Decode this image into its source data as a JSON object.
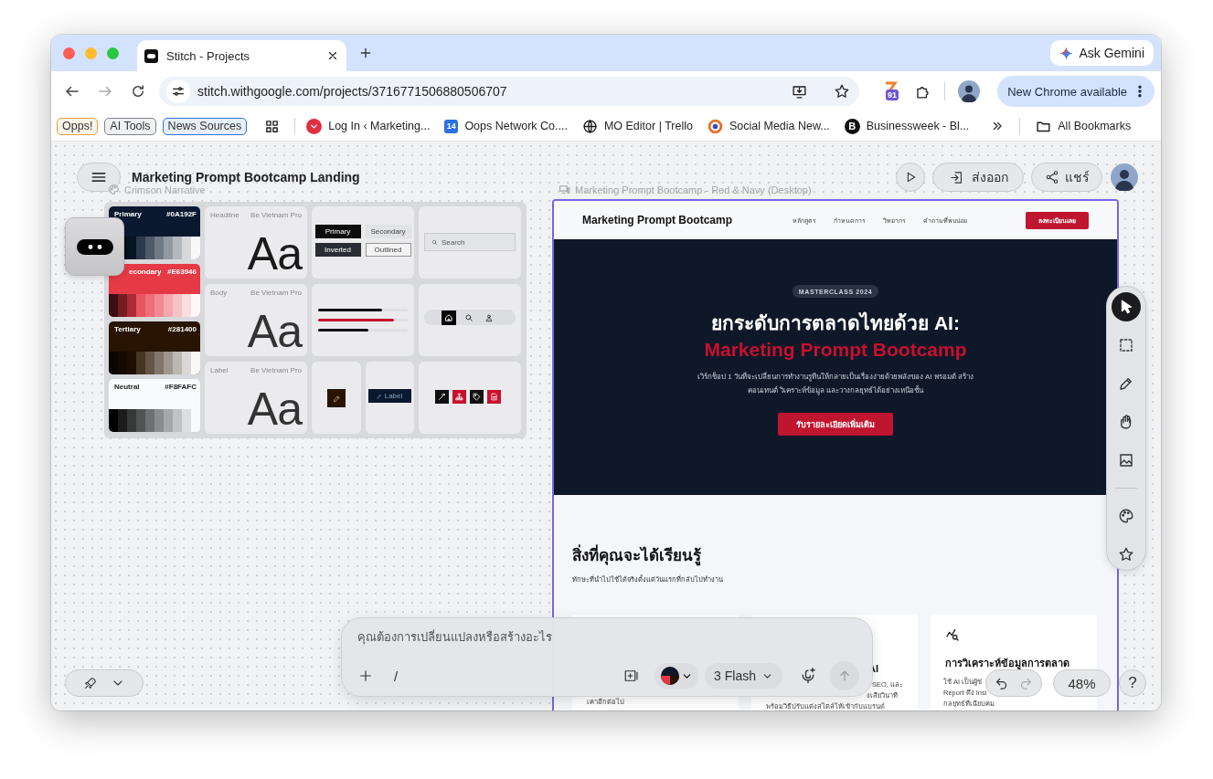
{
  "browser": {
    "tabs": [
      {
        "title": "Stitch - Projects",
        "selected": true
      }
    ],
    "ask_gemini": "Ask Gemini",
    "url": "stitch.withgoogle.com/projects/3716771506880506707",
    "extension_badge": "91",
    "update_button": "New Chrome available",
    "bookmark_chips": [
      {
        "label": "Opps!",
        "color": "#e0a23c"
      },
      {
        "label": "AI Tools",
        "color": "#7d8188"
      },
      {
        "label": "News Sources",
        "color": "#2f6fd0"
      }
    ],
    "bookmarks": [
      {
        "kind": "logo",
        "label": "Log In ‹ Marketing..."
      },
      {
        "kind": "badge",
        "icon_text": "14",
        "label": "Oops Network Co...."
      },
      {
        "kind": "globe",
        "label": "MO Editor | Trello"
      },
      {
        "kind": "swirl",
        "label": "Social Media New..."
      },
      {
        "kind": "letter",
        "icon_text": "B",
        "label": "Businessweek - Bl..."
      }
    ],
    "all_bookmarks": "All Bookmarks"
  },
  "canvas": {
    "project_title": "Marketing Prompt Bootcamp Landing",
    "design_system": {
      "name": "Crimson Narrative",
      "colors": [
        {
          "name": "Primary",
          "hex": "#0A192F",
          "color": "#0a192f"
        },
        {
          "name": "econdary",
          "hex": "#E63946",
          "color": "#e63946"
        },
        {
          "name": "Tertiary",
          "hex": "#281400",
          "color": "#281400"
        },
        {
          "name": "Neutral",
          "hex": "#F8FAFC",
          "color": "#f8fafc"
        }
      ],
      "type_scale": [
        {
          "role": "Headline",
          "font": "Be Vietnam Pro",
          "sample": "Aa"
        },
        {
          "role": "Body",
          "font": "Be Vietnam Pro",
          "sample": "Aa"
        },
        {
          "role": "Label",
          "font": "Be Vietnam Pro",
          "sample": "Aa"
        }
      ],
      "buttons": [
        {
          "kind": "primary",
          "label": "Primary"
        },
        {
          "kind": "secondary",
          "label": "Secondary"
        },
        {
          "kind": "inverted",
          "label": "Inverted"
        },
        {
          "kind": "outlined",
          "label": "Outlined"
        }
      ],
      "progress": [
        {
          "level": 0.71,
          "color": "#111111"
        },
        {
          "level": 0.85,
          "color": "#c8102e"
        },
        {
          "level": 0.56,
          "color": "#111111"
        }
      ],
      "search": {
        "placeholder": "Search"
      },
      "nav_items": [
        {
          "kind": "home",
          "selected": true
        },
        {
          "kind": "search",
          "selected": false
        },
        {
          "kind": "person",
          "selected": false
        }
      ],
      "chip": "Label",
      "icon_tiles": [
        {
          "kind": "wand",
          "color": "#111111"
        },
        {
          "kind": "sitemap",
          "color": "#c8102e"
        },
        {
          "kind": "tag",
          "color": "#111111"
        },
        {
          "kind": "document",
          "color": "#c8102e"
        }
      ]
    },
    "actions": {
      "export": "ส่งออก",
      "share": "แชร์"
    },
    "preview": {
      "label": "Marketing Prompt Bootcamp - Red & Navy (Desktop)",
      "selected": true,
      "nav": {
        "brand": "Marketing Prompt Bootcamp",
        "links": [
          "หลักสูตร",
          "กำหนดการ",
          "วิทยากร",
          "คำถามที่พบบ่อย"
        ],
        "cta": "ลงทะเบียนเลย"
      },
      "hero": {
        "badge": "MASTERCLASS 2024",
        "title": "ยกระดับการตลาดไทยด้วย AI:",
        "title_accent": "Marketing Prompt Bootcamp",
        "body_lines": [
          "เวิร์กช็อป 1 วันที่จะเปลี่ยนการทำงานรูทีนให้กลายเป็นเรื่องง่ายด้วยพลังของ AI พรอมต์ สร้าง",
          "คอนเทนต์ วิเคราะห์ข้อมูล และวางกลยุทธ์ได้อย่างเหนือชั้น"
        ],
        "button": "รับรายละเอียดเพิ่มเติม"
      },
      "section": {
        "title": "สิ่งที่คุณจะได้เรียนรู้",
        "subtitle": "ทักษะที่นำไปใช้ได้จริงตั้งแต่วันแรกที่กลับไปทำงาน",
        "cards": [
          {
            "lines": [
              "เคาอีกต่อไป"
            ]
          },
          {
            "title": "AI",
            "lines": [
              "SEO, และ",
              "งเสียวินาที",
              "พร้อมวิธีปรับแต่งสไตล์ให้เข้ากับแบรนด์"
            ]
          },
          {
            "kind": "icon",
            "title": "การวิเคราะห์ข้อมูลการตลาด",
            "lines": [
              "ใช้ AI เป็นผู้ช่",
              "Report ดึง Insi",
              "กลยุทธ์ที่เฉียบคม"
            ]
          }
        ]
      }
    },
    "tools": [
      {
        "kind": "pointer",
        "selected": true
      },
      {
        "kind": "marquee",
        "selected": false
      },
      {
        "kind": "pencil",
        "selected": false
      },
      {
        "kind": "hand",
        "selected": false
      },
      {
        "kind": "image",
        "selected": false
      }
    ],
    "style_tools": [
      {
        "kind": "palette"
      },
      {
        "kind": "star"
      }
    ],
    "prompt": {
      "placeholder": "คุณต้องการเปลี่ยนแปลงหรือสร้างอะไร",
      "slash": "/",
      "model": "3 Flash",
      "send_disabled": true
    },
    "history": {
      "undo_disabled": false,
      "redo_disabled": true
    },
    "zoom": "48%",
    "help": "?"
  }
}
